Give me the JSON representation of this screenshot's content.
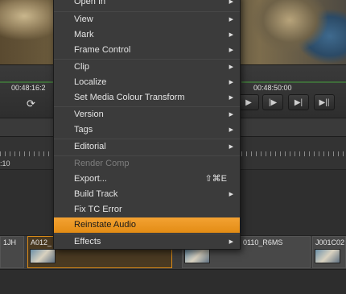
{
  "timeline": {
    "tc_left": "00:48:16:2",
    "tc_right": "00:48:50:00",
    "ruler_label": ":10",
    "loop_icon": "loop-icon"
  },
  "transport_buttons": [
    {
      "icon": "play-icon",
      "glyph": "▶"
    },
    {
      "icon": "step-forward-icon",
      "glyph": "▶|"
    },
    {
      "icon": "next-frame-icon",
      "glyph": "▷|"
    },
    {
      "icon": "jump-end-icon",
      "glyph": "▶||"
    }
  ],
  "clips": [
    {
      "label": "1JH"
    },
    {
      "label": "A012_"
    },
    {
      "label": "0110_R6MS"
    },
    {
      "label": "J001C02"
    }
  ],
  "menu": {
    "items": [
      {
        "label": "Open In",
        "submenu": true
      },
      {
        "label": "View",
        "submenu": true
      },
      {
        "label": "Mark",
        "submenu": true
      },
      {
        "label": "Frame Control",
        "submenu": true
      },
      {
        "label": "Clip",
        "submenu": true
      },
      {
        "label": "Localize",
        "submenu": true
      },
      {
        "label": "Set Media Colour Transform",
        "submenu": true
      },
      {
        "label": "Version",
        "submenu": true
      },
      {
        "label": "Tags",
        "submenu": true
      },
      {
        "label": "Editorial",
        "submenu": true
      },
      {
        "label": "Render Comp",
        "disabled": true
      },
      {
        "label": "Export...",
        "shortcut": "⇧⌘E"
      },
      {
        "label": "Build Track",
        "submenu": true
      },
      {
        "label": "Fix TC Error"
      },
      {
        "label": "Reinstate Audio",
        "highlighted": true
      },
      {
        "label": "Effects",
        "submenu": true
      }
    ],
    "highlight_color": "#f0a030"
  }
}
